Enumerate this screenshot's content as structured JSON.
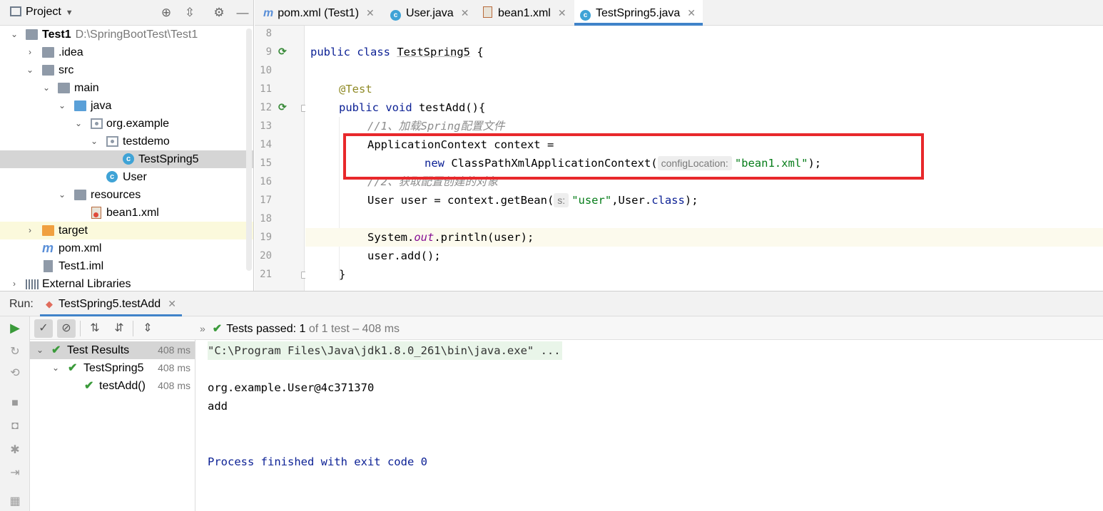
{
  "project": {
    "title": "Project",
    "tree": [
      {
        "label": "Test1",
        "path": "D:\\SpringBootTest\\Test1"
      },
      {
        "label": ".idea"
      },
      {
        "label": "src"
      },
      {
        "label": "main"
      },
      {
        "label": "java"
      },
      {
        "label": "org.example"
      },
      {
        "label": "testdemo"
      },
      {
        "label": "TestSpring5"
      },
      {
        "label": "User"
      },
      {
        "label": "resources"
      },
      {
        "label": "bean1.xml"
      },
      {
        "label": "target"
      },
      {
        "label": "pom.xml"
      },
      {
        "label": "Test1.iml"
      },
      {
        "label": "External Libraries"
      }
    ]
  },
  "editor": {
    "tabs": [
      {
        "label": "pom.xml (Test1)",
        "icon": "maven-icon"
      },
      {
        "label": "User.java",
        "icon": "class-icon"
      },
      {
        "label": "bean1.xml",
        "icon": "xml-icon"
      },
      {
        "label": "TestSpring5.java",
        "icon": "class-icon",
        "active": true
      }
    ],
    "line_numbers": [
      "8",
      "9",
      "10",
      "11",
      "12",
      "13",
      "14",
      "15",
      "16",
      "17",
      "18",
      "19",
      "20",
      "21"
    ],
    "code": {
      "l9_kw": "public class ",
      "l9_name": "TestSpring5",
      "l9_rest": " {",
      "l11": "@Test",
      "l12_kw": "public void ",
      "l12_rest": "testAdd(){",
      "l13": "//1、加载Spring配置文件",
      "l14": "ApplicationContext context =",
      "l15_kw": "new ",
      "l15_cls": "ClassPathXmlApplicationContext(",
      "l15_hint": "configLocation:",
      "l15_str": "\"bean1.xml\"",
      "l15_end": ");",
      "l16": "//2、获取配置创建的对象",
      "l17_a": "User user = context.getBean(",
      "l17_hint": "s:",
      "l17_str": "\"user\"",
      "l17_b": ",User.",
      "l17_kw": "class",
      "l17_c": ");",
      "l19_a": "System.",
      "l19_fld": "out",
      "l19_b": ".println(user);",
      "l20": "user.add();",
      "l21": "}"
    }
  },
  "run": {
    "label": "Run:",
    "tab": "TestSpring5.testAdd",
    "status_prefix": "Tests passed: ",
    "status_count": "1",
    "status_rest": "of 1 test – 408 ms",
    "results": [
      {
        "label": "Test Results",
        "time": "408 ms"
      },
      {
        "label": "TestSpring5",
        "time": "408 ms"
      },
      {
        "label": "testAdd()",
        "time": "408 ms"
      }
    ],
    "console": {
      "cmd": "\"C:\\Program Files\\Java\\jdk1.8.0_261\\bin\\java.exe\" ...",
      "out1": "org.example.User@4c371370",
      "out2": "add",
      "exit": "Process finished with exit code 0"
    }
  },
  "colors": {
    "accent": "#4083c9",
    "highlight_box": "#e8282b",
    "pass_green": "#3a9a3a"
  }
}
